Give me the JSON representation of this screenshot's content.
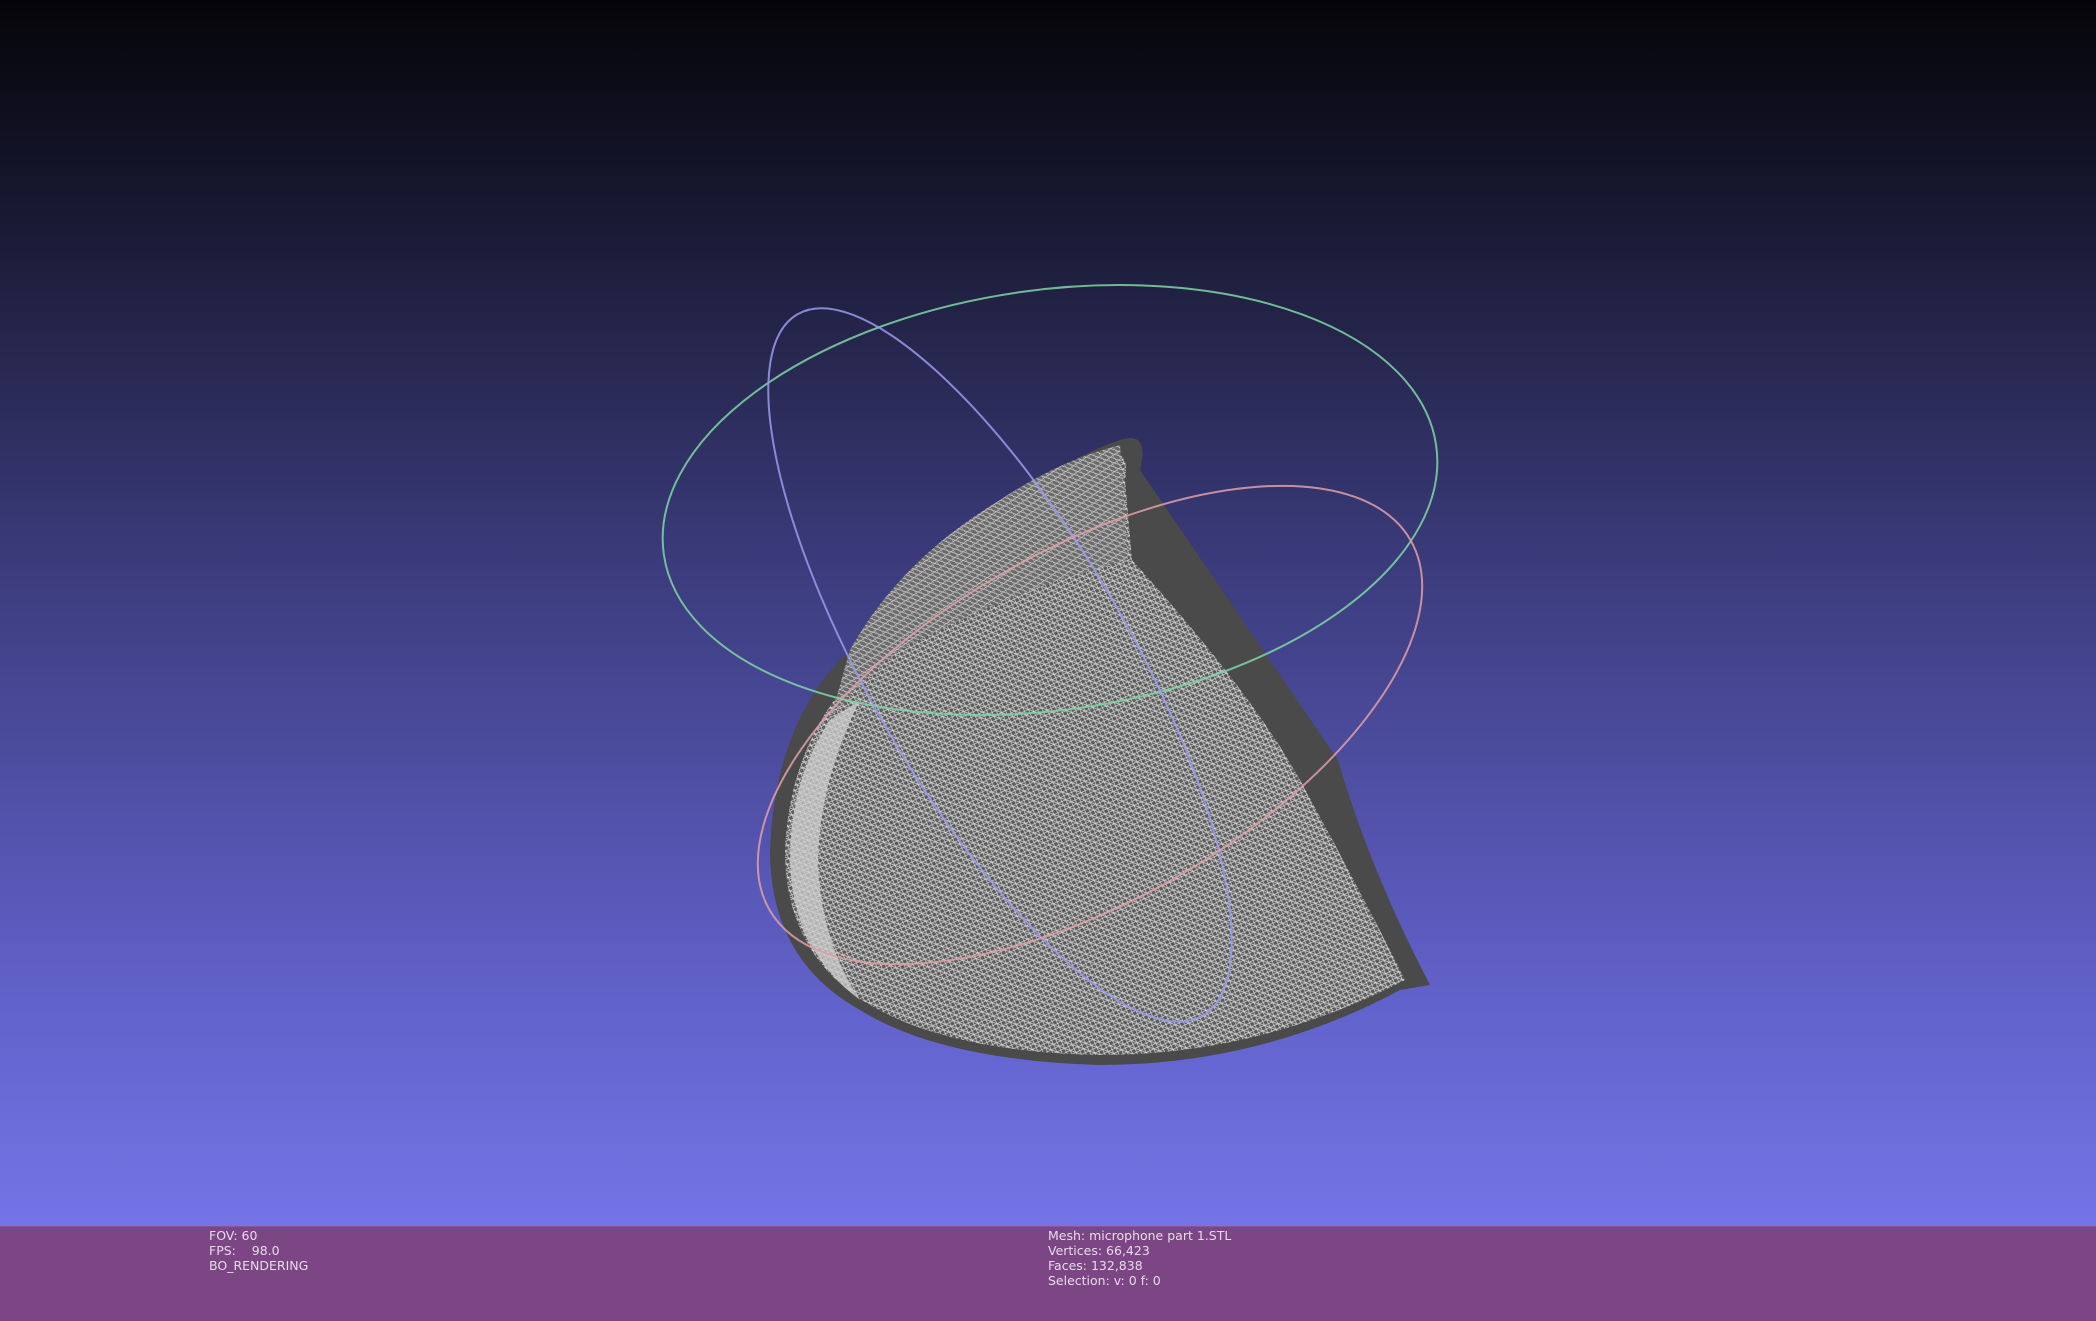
{
  "viewer": {
    "mesh_color": "#4a4a4a",
    "wire_color": "#e0e0e0",
    "trackball_colors": [
      "#7fd6a6",
      "#9a9af0",
      "#e0a0a8",
      "#9a9a9a"
    ]
  },
  "info_left": {
    "fov": "FOV: 60",
    "fps": "FPS:    98.0",
    "render_mode": "BO_RENDERING"
  },
  "info_right": {
    "mesh": "Mesh: microphone part 1.STL",
    "vertices": "Vertices: 66,423",
    "faces": "Faces: 132,838",
    "selection": "Selection: v: 0 f: 0"
  }
}
